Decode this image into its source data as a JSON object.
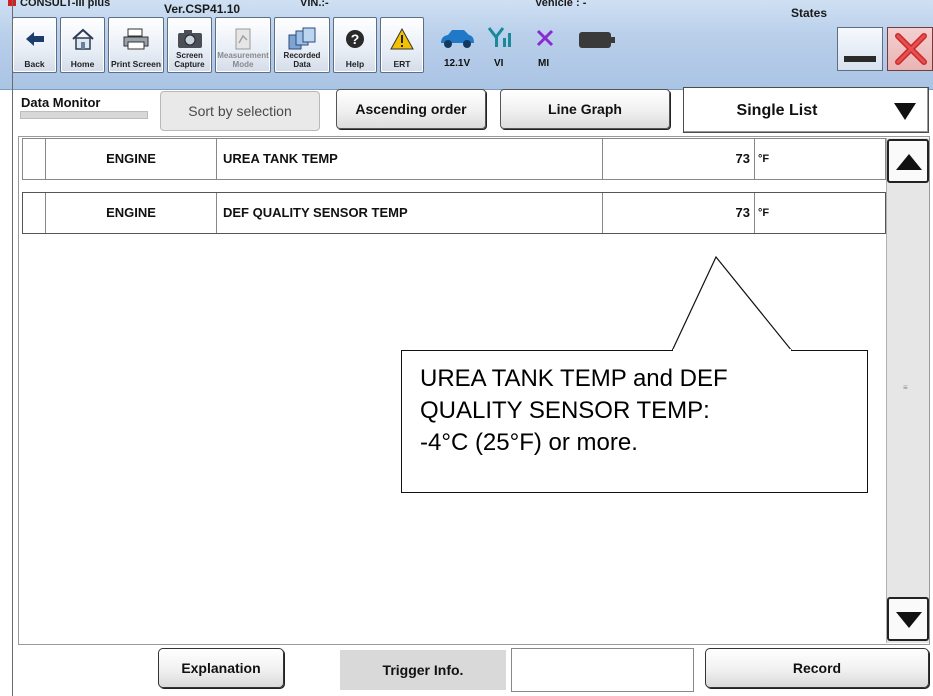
{
  "titlebar": {
    "app_title": "CONSULT-III plus",
    "version": "Ver.CSP41.10",
    "vin_label": "VIN.:-",
    "vehicle_label": "Vehicle : -",
    "states_label": "States"
  },
  "toolbar": {
    "back": "Back",
    "home": "Home",
    "print_screen": "Print Screen",
    "screen_capture": "Screen Capture",
    "measurement_mode": "Measurement Mode",
    "recorded_data": "Recorded Data",
    "help": "Help",
    "ert": "ERT",
    "voltage": "12.1V",
    "vi": "VI",
    "mi": "MI"
  },
  "header": {
    "section_title": "Data Monitor",
    "sort_by_selection": "Sort by selection",
    "ascending_order": "Ascending order",
    "line_graph": "Line Graph",
    "view_select_value": "Single List"
  },
  "rows": [
    {
      "system": "ENGINE",
      "item": "UREA TANK TEMP",
      "value": "73",
      "unit": "°F"
    },
    {
      "system": "ENGINE",
      "item": "DEF QUALITY SENSOR TEMP",
      "value": "73",
      "unit": "°F"
    }
  ],
  "callout": {
    "line1": "UREA TANK TEMP and DEF",
    "line2": "QUALITY SENSOR TEMP:",
    "line3": "-4°C (25°F) or more."
  },
  "footer": {
    "explanation": "Explanation",
    "trigger_info": "Trigger Info.",
    "trigger_value": "",
    "record": "Record"
  },
  "colors": {
    "toolbar_bg": "#b9cfea",
    "close_red": "#cc2b2b",
    "warning_yellow": "#f2c200",
    "car_blue": "#1f78c8",
    "signal_teal": "#1a8a9a",
    "mi_purple": "#8a2bd0"
  },
  "icons": [
    "back-arrow-icon",
    "home-icon",
    "printer-icon",
    "camera-icon",
    "measurement-icon",
    "recorded-data-icon",
    "help-icon",
    "warning-icon",
    "car-icon",
    "signal-icon",
    "mi-x-icon",
    "battery-icon",
    "minimize-icon",
    "close-icon"
  ]
}
